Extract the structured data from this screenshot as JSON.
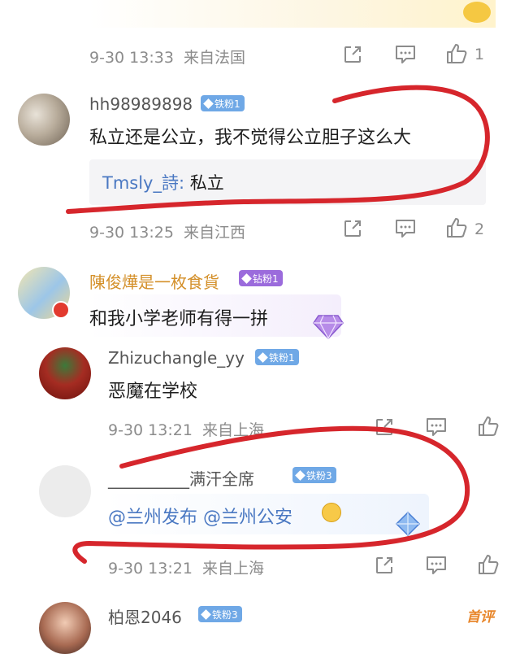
{
  "colors": {
    "accent": "#4a78c2",
    "iron_badge": "#6fa8e6",
    "diamond_badge": "#9b6bdc",
    "annotation": "#d6262c",
    "gold_name": "#d4902a"
  },
  "top_row": {
    "time": "9-30 13:33",
    "location": "来自法国",
    "like_count": "1"
  },
  "comment1": {
    "username": "hh98989898",
    "badge": "铁粉1",
    "text": "私立还是公立，我不觉得公立胆子这么大",
    "reply_user": "Tmsly_詩:",
    "reply_text": "私立",
    "time": "9-30 13:25",
    "location": "来自江西",
    "like_count": "2"
  },
  "comment2": {
    "username": "陳俊燁是一枚食貨",
    "badge": "钻粉1",
    "text": "和我小学老师有得一拼"
  },
  "reply1": {
    "username": "Zhizuchangle_yy",
    "badge": "铁粉1",
    "text": "恶魔在学校",
    "time": "9-30 13:21",
    "location": "来自上海"
  },
  "reply2": {
    "username": "__________满汗全席",
    "badge": "铁粉3",
    "mention1": "@兰州发布",
    "mention2": "@兰州公安",
    "time": "9-30 13:21",
    "location": "来自上海"
  },
  "comment3": {
    "username": "柏恩2046",
    "badge": "铁粉3",
    "tag": "首评"
  },
  "icons": [
    "share-icon",
    "comment-icon",
    "like-icon",
    "diamond-sticker-icon",
    "emoji-icon"
  ]
}
